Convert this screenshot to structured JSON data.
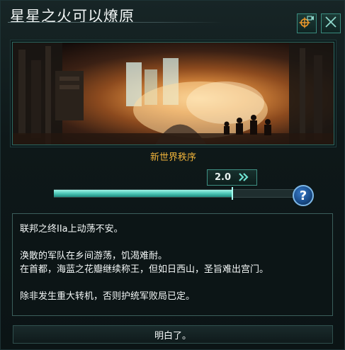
{
  "dialog": {
    "title": "星星之火可以燎原",
    "header_buttons": {
      "locate_icon": "crosshair-camera-icon",
      "close_icon": "close-icon"
    }
  },
  "banner": {
    "caption": "新世界秩序",
    "description": "illustration-wasteland-factory-explosion-soldiers"
  },
  "controls": {
    "speed_label": "2.0",
    "speed_icon": "fast-forward-icon",
    "progress_fraction": 0.74,
    "help_label": "?"
  },
  "message": {
    "lines": [
      "联邦之终IIa上动荡不安。",
      "",
      "涣散的军队在乡间游荡，饥渴难耐。",
      "在首都，海蓝之花瓣继续称王，但如日西山，圣旨难出宫门。",
      "",
      "除非发生重大转机，否则护统军败局已定。"
    ]
  },
  "actions": {
    "confirm_label": "明白了。"
  },
  "colors": {
    "accent": "#f0b33a",
    "teal": "#4fc8b8",
    "border": "#3a8b7e"
  }
}
